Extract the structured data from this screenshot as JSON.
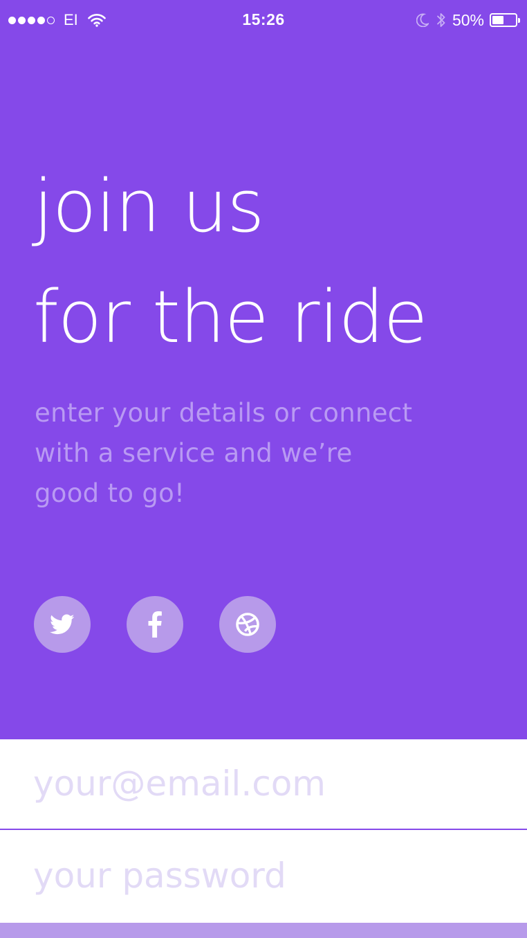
{
  "status_bar": {
    "carrier": "EI",
    "time": "15:26",
    "battery_percent": "50%",
    "battery_level": 0.5,
    "signal_bars_filled": 4,
    "signal_bars_total": 5
  },
  "hero": {
    "headline": [
      "join us",
      "for the ride"
    ],
    "subtitle": [
      "enter your details or connect",
      "with a service and we’re",
      "good to go!"
    ],
    "background_color": "#8549e9"
  },
  "social_buttons": [
    {
      "service": "twitter",
      "icon": "twitter-icon"
    },
    {
      "service": "facebook",
      "icon": "facebook-icon"
    },
    {
      "service": "dribbble",
      "icon": "dribbble-icon"
    }
  ],
  "form": {
    "email_placeholder": "your@email.com",
    "email_value": "",
    "password_placeholder": "your password",
    "password_value": ""
  },
  "colors": {
    "accent": "#8549e9",
    "accent_light": "#b79aea",
    "subtitle": "#b99af3",
    "placeholder": "#e2daf6"
  }
}
